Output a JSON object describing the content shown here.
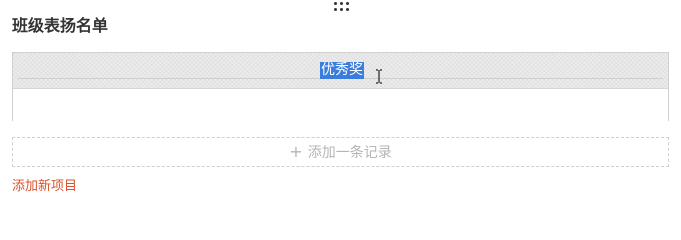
{
  "section": {
    "title": "班级表扬名单"
  },
  "table": {
    "header_cell": "优秀奖",
    "rows": [
      ""
    ]
  },
  "add_record": {
    "icon": "plus-icon",
    "label": "添加一条记录"
  },
  "add_item": {
    "label": "添加新项目"
  },
  "colors": {
    "title_text": "#333333",
    "selection": "#3b7ddd",
    "add_item_text": "#d9532c",
    "dashed_border": "#cfcfcf",
    "muted_text": "#b5b5b5"
  }
}
